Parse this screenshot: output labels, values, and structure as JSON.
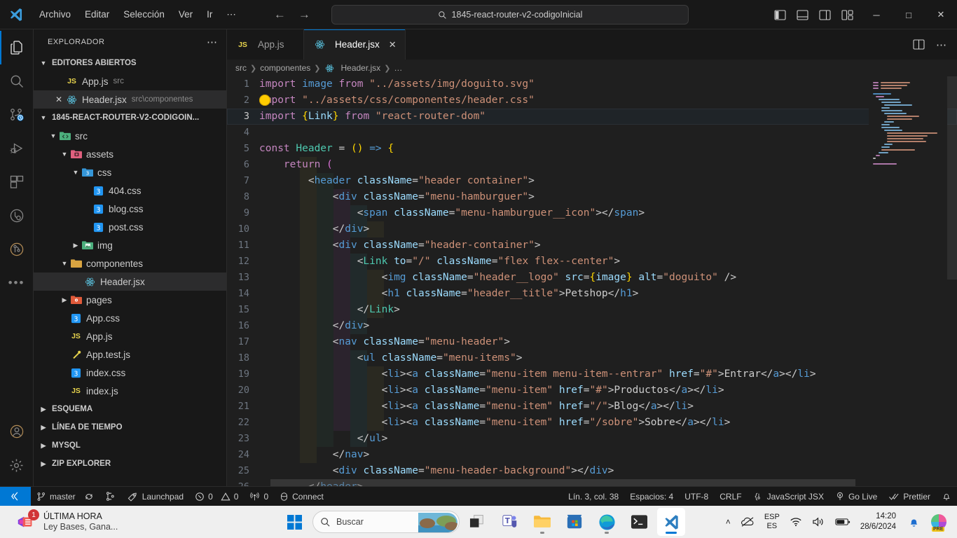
{
  "titlebar": {
    "menu": [
      "Archivo",
      "Editar",
      "Selección",
      "Ver",
      "Ir",
      "⋯"
    ],
    "quick_open_value": "1845-react-router-v2-codigoInicial",
    "back_arrow": "←",
    "forward_arrow": "→",
    "minimize": "─",
    "maximize": "□",
    "close": "✕"
  },
  "activitybar": {
    "items": [
      {
        "name": "explorer",
        "active": true
      },
      {
        "name": "search",
        "active": false
      },
      {
        "name": "source-control",
        "active": false
      },
      {
        "name": "run-and-debug",
        "active": false
      },
      {
        "name": "extensions",
        "active": false
      },
      {
        "name": "testing",
        "active": false
      },
      {
        "name": "git-graph",
        "active": false
      },
      {
        "name": "more-views",
        "active": false
      }
    ],
    "bottom": [
      {
        "name": "accounts"
      },
      {
        "name": "manage-settings"
      }
    ]
  },
  "sidebar": {
    "title": "EXPLORADOR",
    "more_actions": "⋯",
    "sections": [
      {
        "label": "EDITORES ABIERTOS",
        "expanded": true
      },
      {
        "label": "1845-REACT-ROUTER-V2-CODIGOIN...",
        "expanded": true
      },
      {
        "label": "ESQUEMA",
        "expanded": false
      },
      {
        "label": "LÍNEA DE TIEMPO",
        "expanded": false
      },
      {
        "label": "MYSQL",
        "expanded": false
      },
      {
        "label": "ZIP EXPLORER",
        "expanded": false
      }
    ],
    "open_editors": [
      {
        "name": "App.js",
        "path": "src",
        "icon": "js-icon",
        "selected": false,
        "show_close": false
      },
      {
        "name": "Header.jsx",
        "path": "src\\componentes",
        "icon": "react-icon",
        "selected": true,
        "show_close": true
      }
    ],
    "tree": [
      {
        "label": "src",
        "icon": "folder-src-icon",
        "indent": 1,
        "type": "folder",
        "expanded": true
      },
      {
        "label": "assets",
        "icon": "folder-assets-icon",
        "indent": 2,
        "type": "folder",
        "expanded": true
      },
      {
        "label": "css",
        "icon": "folder-css-icon",
        "indent": 3,
        "type": "folder",
        "expanded": true
      },
      {
        "label": "404.css",
        "icon": "css-icon",
        "indent": 4,
        "type": "file"
      },
      {
        "label": "blog.css",
        "icon": "css-icon",
        "indent": 4,
        "type": "file"
      },
      {
        "label": "post.css",
        "icon": "css-icon",
        "indent": 4,
        "type": "file"
      },
      {
        "label": "img",
        "icon": "folder-img-icon",
        "indent": 3,
        "type": "folder",
        "expanded": false
      },
      {
        "label": "componentes",
        "icon": "folder-icon",
        "indent": 2,
        "type": "folder",
        "expanded": true
      },
      {
        "label": "Header.jsx",
        "icon": "react-icon",
        "indent": 3,
        "type": "file",
        "selected": true
      },
      {
        "label": "pages",
        "icon": "folder-pages-icon",
        "indent": 2,
        "type": "folder",
        "expanded": false
      },
      {
        "label": "App.css",
        "icon": "css-icon",
        "indent": 2,
        "type": "file"
      },
      {
        "label": "App.js",
        "icon": "js-icon",
        "indent": 2,
        "type": "file"
      },
      {
        "label": "App.test.js",
        "icon": "test-icon",
        "indent": 2,
        "type": "file"
      },
      {
        "label": "index.css",
        "icon": "css-icon",
        "indent": 2,
        "type": "file"
      },
      {
        "label": "index.js",
        "icon": "js-icon",
        "indent": 2,
        "type": "file"
      }
    ]
  },
  "editor": {
    "tabs": [
      {
        "label": "App.js",
        "icon": "js-icon",
        "active": false,
        "dirty": false,
        "show_close": false
      },
      {
        "label": "Header.jsx",
        "icon": "react-icon",
        "active": true,
        "dirty": false,
        "show_close": true
      }
    ],
    "breadcrumb": [
      "src",
      "componentes",
      "Header.jsx",
      "…"
    ],
    "split_editor_label": "split-editor",
    "more_actions_label": "⋯",
    "code_lines": [
      {
        "n": 1,
        "text": "import image from \"../assets/img/doguito.svg\""
      },
      {
        "n": 2,
        "text": "import \"../assets/css/componentes/header.css\""
      },
      {
        "n": 3,
        "text": "import {Link} from \"react-router-dom\""
      },
      {
        "n": 4,
        "text": ""
      },
      {
        "n": 5,
        "text": "const Header = () => {"
      },
      {
        "n": 6,
        "text": "    return ("
      },
      {
        "n": 7,
        "text": "        <header className=\"header container\">"
      },
      {
        "n": 8,
        "text": "            <div className=\"menu-hamburguer\">"
      },
      {
        "n": 9,
        "text": "                <span className=\"menu-hamburguer__icon\"></span>"
      },
      {
        "n": 10,
        "text": "            </div>"
      },
      {
        "n": 11,
        "text": "            <div className=\"header-container\">"
      },
      {
        "n": 12,
        "text": "                <Link to=\"/\" className=\"flex flex--center\">"
      },
      {
        "n": 13,
        "text": "                    <img className=\"header__logo\" src={image} alt=\"doguito\" />"
      },
      {
        "n": 14,
        "text": "                    <h1 className=\"header__title\">Petshop</h1>"
      },
      {
        "n": 15,
        "text": "                </Link>"
      },
      {
        "n": 16,
        "text": "            </div>"
      },
      {
        "n": 17,
        "text": "            <nav className=\"menu-header\">"
      },
      {
        "n": 18,
        "text": "                <ul className=\"menu-items\">"
      },
      {
        "n": 19,
        "text": "                    <li><a className=\"menu-item menu-item--entrar\" href=\"#\">Entrar</a></li>"
      },
      {
        "n": 20,
        "text": "                    <li><a className=\"menu-item\" href=\"#\">Productos</a></li>"
      },
      {
        "n": 21,
        "text": "                    <li><a className=\"menu-item\" href=\"/\">Blog</a></li>"
      },
      {
        "n": 22,
        "text": "                    <li><a className=\"menu-item\" href=\"/sobre\">Sobre</a></li>"
      },
      {
        "n": 23,
        "text": "                </ul>"
      },
      {
        "n": 24,
        "text": "            </nav>"
      },
      {
        "n": 25,
        "text": "            <div className=\"menu-header-background\"></div>"
      },
      {
        "n": 26,
        "text": "        </header>"
      }
    ],
    "cursor_line": 3
  },
  "statusbar": {
    "remote_icon": "remote-window-icon",
    "branch": "master",
    "sync_icon": "sync-icon",
    "compare_icon": "git-compare-icon",
    "launchpad": "Launchpad",
    "errors": "0",
    "warnings": "0",
    "ports": "0",
    "connect": "Connect",
    "position": "Lín. 3, col. 38",
    "indentation": "Espacios: 4",
    "encoding": "UTF-8",
    "eol": "CRLF",
    "language": "JavaScript JSX",
    "golive": "Go Live",
    "prettier": "Prettier",
    "bell_icon": "bell-icon"
  },
  "taskbar": {
    "notification": {
      "title": "ÚLTIMA HORA",
      "body": "Ley Bases, Gana...",
      "badge": "1"
    },
    "search_placeholder": "Buscar",
    "apps": [
      {
        "name": "start-button"
      },
      {
        "name": "task-view"
      },
      {
        "name": "microsoft-teams"
      },
      {
        "name": "file-explorer"
      },
      {
        "name": "microsoft-store"
      },
      {
        "name": "microsoft-edge"
      },
      {
        "name": "windows-terminal"
      },
      {
        "name": "visual-studio-code",
        "active": true
      }
    ],
    "tray": {
      "chevron": "˄",
      "lang_line1": "ESP",
      "lang_line2": "ES",
      "time": "14:20",
      "date": "28/6/2024",
      "copilot_badge": "PRE"
    }
  },
  "colors": {
    "accent": "#0078d4",
    "editor_bg": "#1f1f1f",
    "chrome_bg": "#181818",
    "taskbar_bg": "#efefef"
  }
}
